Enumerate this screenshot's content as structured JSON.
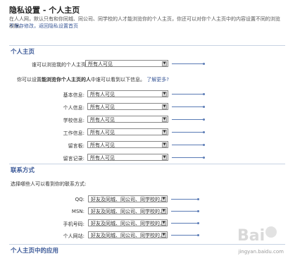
{
  "header": {
    "title": "隐私设置 - 个人主页",
    "intro": "在人人网，默认只有和你同城、同公司、同学校的人才能浏览你的个人主页，你还可以对你个人主页中的内容设置不同的浏览权限。",
    "link_unsaved": "不保存修改",
    "link_return": "返回隐私设置首页"
  },
  "sections": {
    "profile": "个人主页",
    "contact": "联系方式",
    "apps": "个人主页中的应用"
  },
  "profile": {
    "who_label": "谁可以浏览我的个人主页:",
    "who_value": "所有人可见",
    "note_prefix": "你可以设置",
    "note_bold": "能浏览你个人主页的人",
    "note_suffix": "中谁可以看到以下信息。",
    "learn_more": "了解更多?",
    "rows": [
      {
        "label": "基本信息:",
        "value": "所有人可见"
      },
      {
        "label": "个人信息:",
        "value": "所有人可见"
      },
      {
        "label": "学校信息:",
        "value": "所有人可见"
      },
      {
        "label": "工作信息:",
        "value": "所有人可见"
      },
      {
        "label": "留言板:",
        "value": "所有人可见"
      },
      {
        "label": "留言记录:",
        "value": "所有人可见"
      }
    ]
  },
  "contact": {
    "intro": "选择哪些人可以看到你的联系方式:",
    "rows": [
      {
        "label": "QQ:",
        "value": "好友及同城、同公司、同学校的人"
      },
      {
        "label": "MSN:",
        "value": "好友及同城、同公司、同学校的人"
      },
      {
        "label": "手机号码:",
        "value": "好友及同城、同公司、同学校的人"
      },
      {
        "label": "个人网站:",
        "value": "好友及同城、同公司、同学校的人"
      }
    ]
  },
  "watermark": {
    "text": "jingyan.baidu.com"
  }
}
